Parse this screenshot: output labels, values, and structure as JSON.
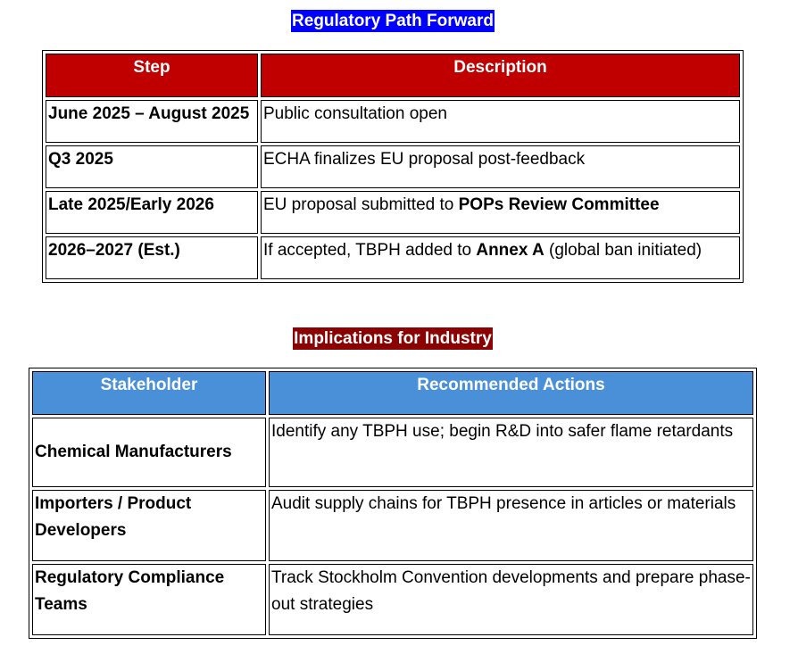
{
  "section1": {
    "title": "Regulatory Path Forward",
    "headers": [
      "Step",
      "Description"
    ],
    "rows": [
      {
        "step": "June 2025 – August 2025",
        "desc_before": "Public consultation open",
        "desc_bold": "",
        "desc_after": ""
      },
      {
        "step": "Q3 2025",
        "desc_before": "ECHA finalizes EU proposal post-feedback",
        "desc_bold": "",
        "desc_after": ""
      },
      {
        "step": "Late 2025/Early 2026",
        "desc_before": "EU proposal submitted to ",
        "desc_bold": "POPs Review Committee",
        "desc_after": ""
      },
      {
        "step": "2026–2027 (Est.)",
        "desc_before": "If accepted, TBPH added to ",
        "desc_bold": "Annex A",
        "desc_after": " (global ban initiated)"
      }
    ]
  },
  "section2": {
    "title": "Implications for Industry",
    "headers": [
      "Stakeholder",
      "Recommended Actions"
    ],
    "rows": [
      {
        "stakeholder": "Chemical Manufacturers",
        "action": "Identify any TBPH use; begin R&D into safer flame retardants"
      },
      {
        "stakeholder": "Importers / Product Developers",
        "action": "Audit supply chains for TBPH presence in articles or materials"
      },
      {
        "stakeholder": "Regulatory Compliance Teams",
        "action": "Track Stockholm Convention developments and prepare phase-out strategies"
      }
    ]
  },
  "colors": {
    "title1_bg": "#0000ff",
    "title2_bg": "#8b0000",
    "table1_header_bg": "#c00000",
    "table2_header_bg": "#4a90d9"
  }
}
